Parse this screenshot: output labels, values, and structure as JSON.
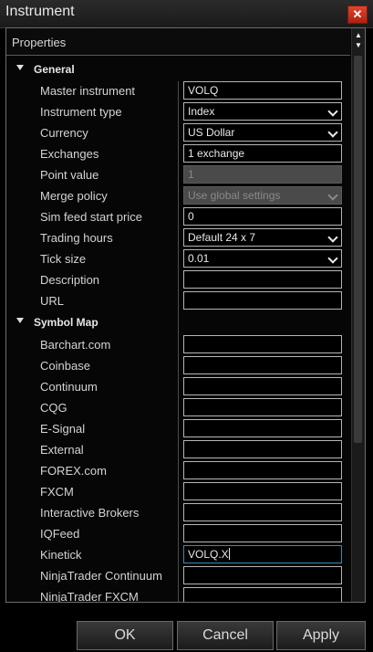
{
  "window": {
    "title": "Instrument",
    "close_glyph": "✕"
  },
  "panel": {
    "header": "Properties"
  },
  "categories": {
    "general": "General",
    "symbol_map": "Symbol Map"
  },
  "general": [
    {
      "label": "Master instrument",
      "value": "VOLQ",
      "kind": "text"
    },
    {
      "label": "Instrument type",
      "value": "Index",
      "kind": "dropdown"
    },
    {
      "label": "Currency",
      "value": "US Dollar",
      "kind": "dropdown"
    },
    {
      "label": "Exchanges",
      "value": "1 exchange",
      "kind": "text"
    },
    {
      "label": "Point value",
      "value": "1",
      "kind": "disabled"
    },
    {
      "label": "Merge policy",
      "value": "Use global settings",
      "kind": "disabled-dropdown"
    },
    {
      "label": "Sim feed start price",
      "value": "0",
      "kind": "text"
    },
    {
      "label": "Trading hours",
      "value": "Default 24 x 7",
      "kind": "dropdown"
    },
    {
      "label": "Tick size",
      "value": "0.01",
      "kind": "dropdown"
    },
    {
      "label": "Description",
      "value": "",
      "kind": "text"
    },
    {
      "label": "URL",
      "value": "",
      "kind": "text"
    }
  ],
  "symbol_map": [
    {
      "label": "Barchart.com",
      "value": ""
    },
    {
      "label": "Coinbase",
      "value": ""
    },
    {
      "label": "Continuum",
      "value": ""
    },
    {
      "label": "CQG",
      "value": ""
    },
    {
      "label": "E-Signal",
      "value": ""
    },
    {
      "label": "External",
      "value": ""
    },
    {
      "label": "FOREX.com",
      "value": ""
    },
    {
      "label": "FXCM",
      "value": ""
    },
    {
      "label": "Interactive Brokers",
      "value": ""
    },
    {
      "label": "IQFeed",
      "value": ""
    },
    {
      "label": "Kinetick",
      "value": "VOLQ.X"
    },
    {
      "label": "NinjaTrader Continuum",
      "value": ""
    },
    {
      "label": "NinjaTrader FXCM",
      "value": ""
    }
  ],
  "buttons": {
    "ok": "OK",
    "cancel": "Cancel",
    "apply": "Apply"
  }
}
